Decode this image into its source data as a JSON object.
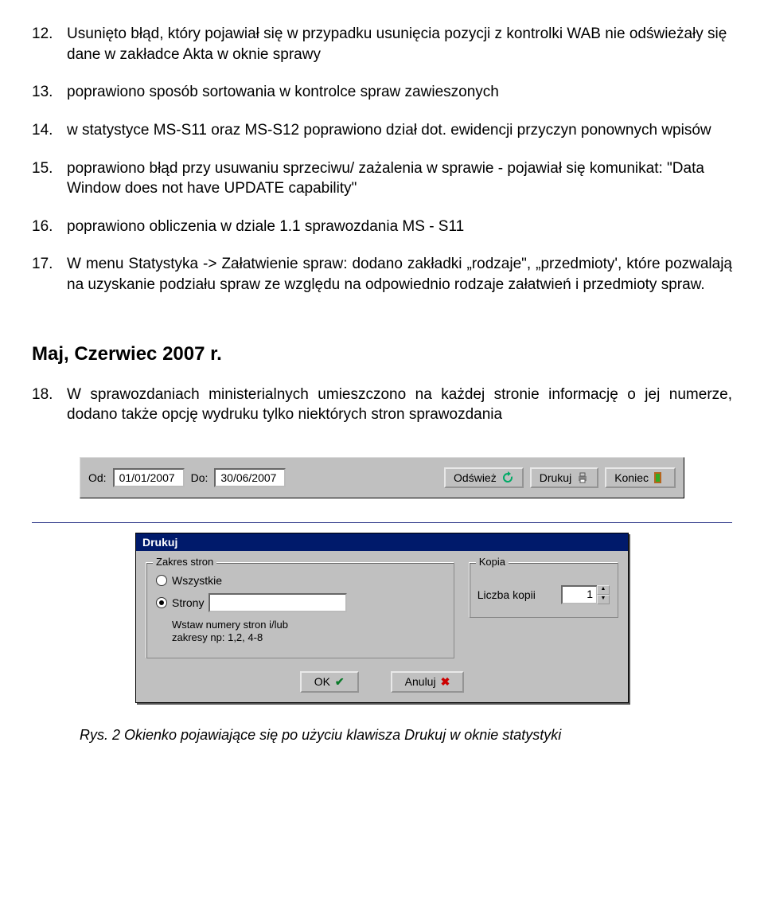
{
  "items": [
    {
      "num": "12.",
      "text": "Usunięto błąd, który pojawiał się w przypadku usunięcia pozycji z kontrolki WAB nie odświeżały się dane w zakładce Akta w oknie sprawy",
      "justify": false
    },
    {
      "num": "13.",
      "text": "poprawiono sposób sortowania w kontrolce spraw zawieszonych",
      "justify": false
    },
    {
      "num": "14.",
      "text": "w statystyce MS-S11 oraz  MS-S12 poprawiono dział dot.  ewidencji przyczyn ponownych wpisów",
      "justify": false
    },
    {
      "num": "15.",
      "text": "poprawiono błąd przy usuwaniu sprzeciwu/ zażalenia w sprawie - pojawiał się komunikat: \"Data Window does not have UPDATE capability\"",
      "justify": false
    },
    {
      "num": "16.",
      "text": "poprawiono obliczenia w dziale 1.1 sprawozdania MS - S11",
      "justify": false
    },
    {
      "num": "17.",
      "text": "W menu Statystyka -> Załatwienie spraw: dodano zakładki „rodzaje\", „przedmioty', które pozwalają na uzyskanie podziału spraw ze względu na odpowiednio rodzaje załatwień i przedmioty spraw.",
      "justify": true
    }
  ],
  "section_heading": "Maj, Czerwiec 2007 r.",
  "items2": [
    {
      "num": "18.",
      "text": "W sprawozdaniach ministerialnych umieszczono na każdej stronie informację o jej numerze, dodano także opcję wydruku tylko niektórych stron sprawozdania",
      "justify": true
    }
  ],
  "toolbar": {
    "od_label": "Od:",
    "od_value": "01/01/2007",
    "do_label": "Do:",
    "do_value": "30/06/2007",
    "refresh": "Odśwież",
    "print": "Drukuj",
    "close": "Koniec"
  },
  "dialog": {
    "title": "Drukuj",
    "zakres_legend": "Zakres stron",
    "opt_all": "Wszystkie",
    "opt_pages": "Strony",
    "hint1": "Wstaw numery stron  i/lub",
    "hint2": "zakresy np: 1,2, 4-8",
    "kopia_legend": "Kopia",
    "liczba_kopii_label": "Liczba kopii",
    "liczba_kopii_value": "1",
    "ok": "OK",
    "cancel": "Anuluj"
  },
  "caption": "Rys. 2 Okienko pojawiające się po użyciu klawisza Drukuj w oknie statystyki"
}
